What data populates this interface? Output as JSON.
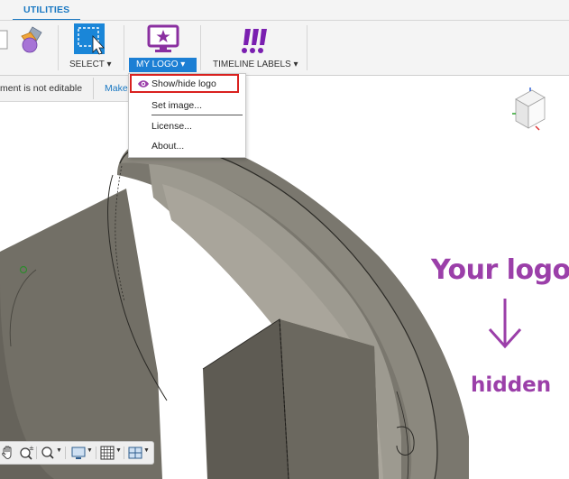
{
  "ribbon": {
    "active_tab": "UTILITIES",
    "tools": {
      "select_label": "SELECT ▾",
      "my_logo_label": "MY LOGO ▾",
      "timeline_labels_label": "TIMELINE LABELS ▾"
    }
  },
  "notice": {
    "text": "ment is not editable",
    "link": "Make"
  },
  "logo_menu": {
    "items": [
      {
        "label": "Show/hide logo",
        "icon": "eye-icon",
        "highlighted": true
      },
      {
        "label": "Set image..."
      },
      {
        "label": "License..."
      },
      {
        "label": "About..."
      }
    ]
  },
  "annotation": {
    "title": "Your logo",
    "subtitle": "hidden",
    "color": "#9b3fa9"
  },
  "colors": {
    "accent": "#1c7fd4",
    "highlight_border": "#d9211f",
    "annotation": "#9b3fa9",
    "model_body": "#6f6c64"
  }
}
